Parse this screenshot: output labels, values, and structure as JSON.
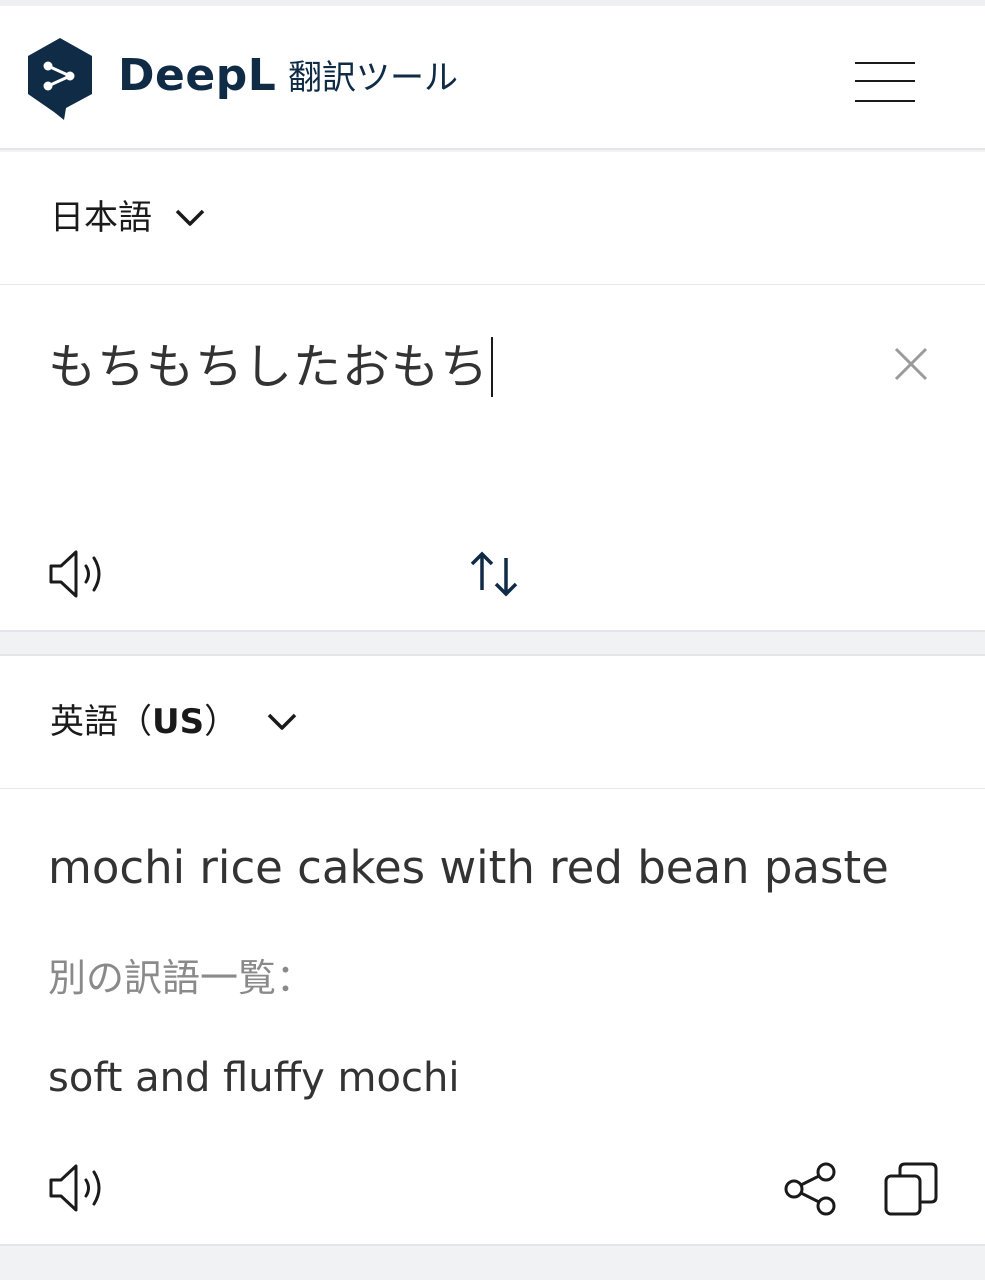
{
  "header": {
    "brand_name": "DeepL",
    "brand_sub": "翻訳ツール",
    "icons": {
      "logo": "deepl-logo-icon",
      "menu": "hamburger-menu-icon"
    },
    "brand_color": "#0f2b46"
  },
  "source": {
    "language": "日本語",
    "text": "もちもちしたおもち",
    "icons": {
      "clear": "close-icon",
      "speaker": "speaker-icon",
      "swap": "swap-languages-icon",
      "dropdown": "chevron-down-icon"
    }
  },
  "target": {
    "language_prefix": "英語（",
    "language_code": "US",
    "language_suffix": "）",
    "translation": "mochi rice cakes with red bean paste",
    "alternatives_heading": "別の訳語一覧：",
    "alternatives": [
      "soft and fluffy mochi"
    ],
    "icons": {
      "speaker": "speaker-icon",
      "share": "share-icon",
      "copy": "copy-icon",
      "dropdown": "chevron-down-icon"
    }
  }
}
